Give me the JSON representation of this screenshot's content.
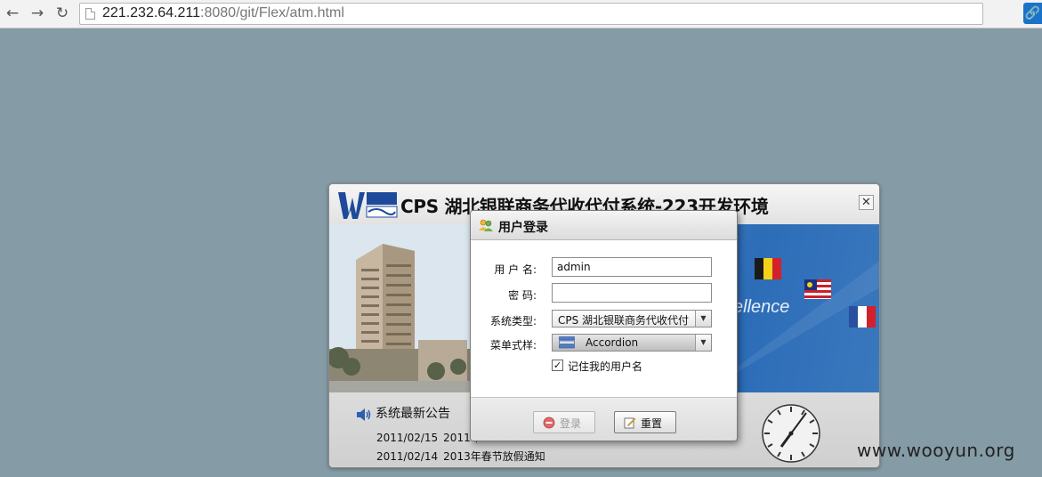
{
  "browser": {
    "url_host": "221.232.64.211",
    "url_rest": ":8080/git/Flex/atm.html"
  },
  "app": {
    "title": "CPS 湖北银联商务代收代付系统-223开发环境",
    "banner_text": "ellence",
    "notice": {
      "title": "系统最新公告",
      "items": [
        {
          "date": "2011/02/15",
          "text": "2011年"
        },
        {
          "date": "2011/02/14",
          "text": "2013年春节放假通知"
        }
      ]
    }
  },
  "login": {
    "title": "用户登录",
    "username_label": "用 户 名:",
    "username_value": "admin",
    "password_label": "密 码:",
    "password_value": "",
    "system_type_label": "系统类型:",
    "system_type_value": "CPS 湖北银联商务代收代付",
    "menu_style_label": "菜单式样:",
    "menu_style_value": "Accordion",
    "remember_label": "记住我的用户名",
    "remember_checked": true,
    "login_button": "登录",
    "reset_button": "重置"
  },
  "watermark": "www.wooyun.org",
  "icons": {
    "back": "back-arrow-icon",
    "forward": "forward-arrow-icon",
    "reload": "reload-icon",
    "page": "page-icon",
    "close": "close-icon",
    "speaker": "speaker-icon",
    "users": "users-icon",
    "clock": "clock-icon"
  }
}
